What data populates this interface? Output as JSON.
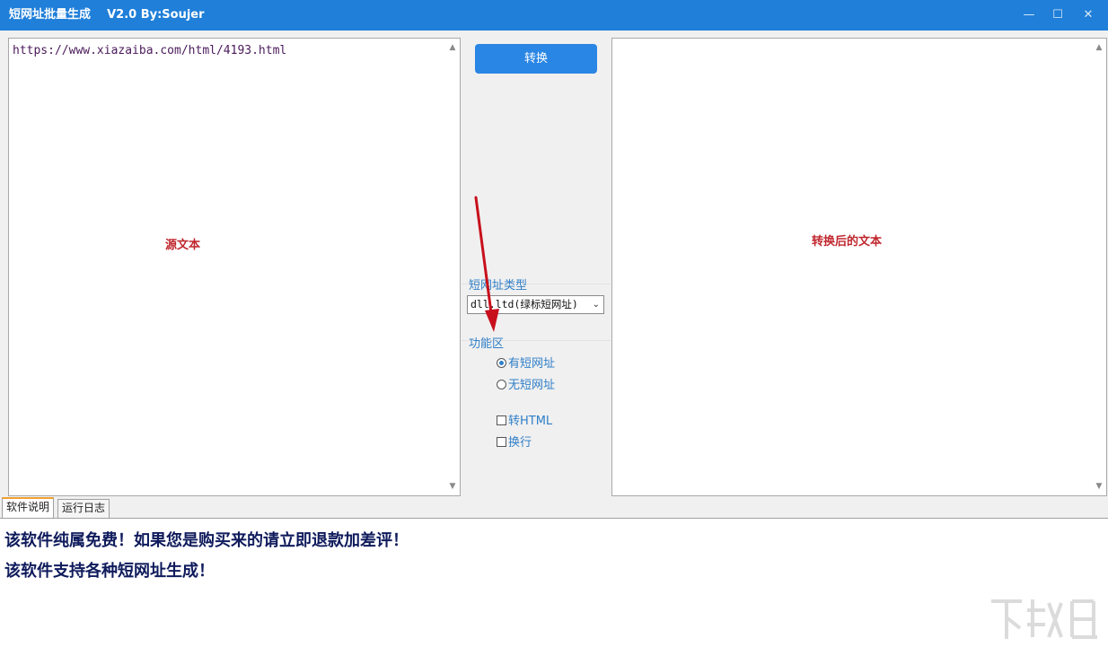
{
  "window": {
    "title": "短网址批量生成    V2.0 By:Soujer",
    "minimize_glyph": "—",
    "maximize_glyph": "☐",
    "close_glyph": "✕"
  },
  "source_pane": {
    "content": "https://www.xiazaiba.com/html/4193.html",
    "label": "源文本"
  },
  "result_pane": {
    "content": "",
    "label": "转换后的文本"
  },
  "controls": {
    "convert_label": "转换",
    "short_url_type_title": "短网址类型",
    "short_url_type_selected": "dll.ltd(绿标短网址)",
    "function_area_title": "功能区",
    "radio_has_short": "有短网址",
    "radio_no_short": "无短网址",
    "check_html": "转HTML",
    "check_newline": "换行"
  },
  "tabs": [
    {
      "label": "软件说明",
      "active": true
    },
    {
      "label": "运行日志",
      "active": false
    }
  ],
  "description": {
    "line1": "该软件纯属免费！如果您是购买来的请立即退款加差评！",
    "line2": "该软件支持各种短网址生成！"
  },
  "colors": {
    "titlebar": "#1f7fd9",
    "accent_blue": "#2a86e4",
    "label_red": "#c0262d",
    "desc_navy": "#0f1b5c"
  },
  "icons": {
    "scroll_up": "up-arrow-icon",
    "scroll_down": "down-arrow-icon",
    "dropdown": "chevron-down-icon"
  }
}
